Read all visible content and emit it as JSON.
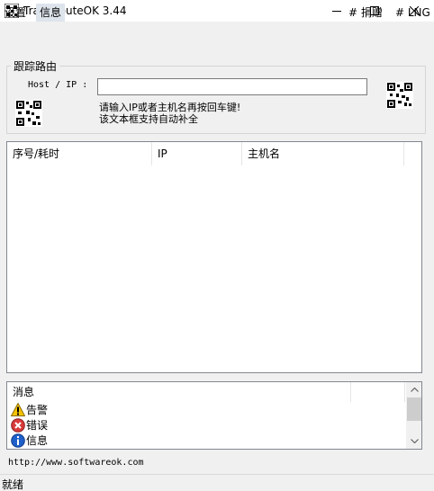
{
  "window": {
    "title": "TraceRouteOK 3.44",
    "minimize_icon": "minimize-icon",
    "maximize_icon": "maximize-icon",
    "close_icon": "close-icon"
  },
  "menu": {
    "settings": "设置",
    "info": "信息",
    "donate": "# 捐赠",
    "lng": "# LNG"
  },
  "trace": {
    "group_title": "跟踪路由",
    "host_label": "Host / IP :",
    "host_value": "",
    "hint_line1": "请输入IP或者主机名再按回车键!",
    "hint_line2": "该文本框支持自动补全"
  },
  "results": {
    "columns": [
      "序号/耗时",
      "IP",
      "主机名"
    ]
  },
  "messages": {
    "header": "消息",
    "items": [
      {
        "icon": "warning-icon",
        "label": "告警"
      },
      {
        "icon": "error-icon",
        "label": "错误"
      },
      {
        "icon": "info-icon",
        "label": "信息"
      }
    ]
  },
  "footer": {
    "url": "http://www.softwareok.com",
    "status": "就绪"
  },
  "colors": {
    "warning": "#f5c400",
    "error": "#d83b3b",
    "info": "#1e5fc9"
  }
}
